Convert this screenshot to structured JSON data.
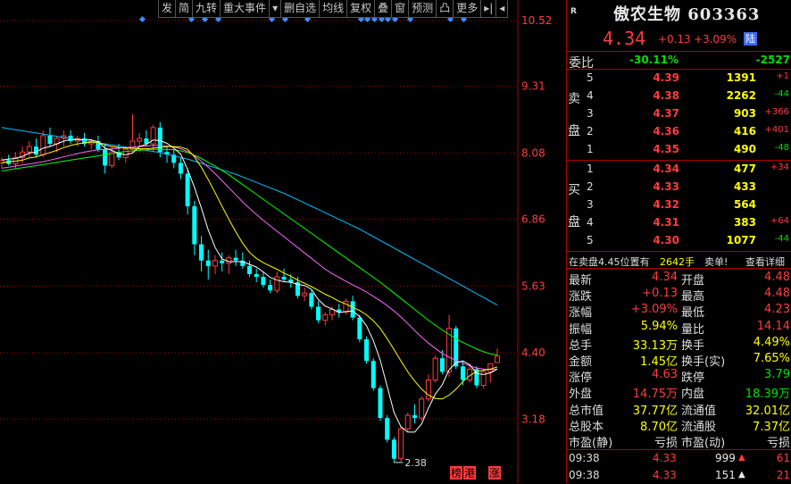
{
  "toolbar": {
    "buttons": [
      "发",
      "简",
      "九转",
      "重大事件",
      "▾",
      "删自选",
      "均线",
      "复权",
      "叠",
      "窗",
      "预测",
      "凸",
      "更多",
      "▸|",
      "◂"
    ]
  },
  "stock": {
    "tag": "R",
    "name": "傲农生物",
    "code": "603363",
    "price": "4.34",
    "change": "+0.13",
    "change_pct": "+3.09%",
    "market": "陆"
  },
  "webi": {
    "label": "委比",
    "pct": "-30.11%",
    "diff": "-2527"
  },
  "order_book": {
    "sell_label": [
      "卖",
      "盘"
    ],
    "buy_label": [
      "买",
      "盘"
    ],
    "sells": [
      {
        "idx": "5",
        "price": "4.39",
        "vol": "1391",
        "chg": "+1"
      },
      {
        "idx": "4",
        "price": "4.38",
        "vol": "2262",
        "chg": "-44"
      },
      {
        "idx": "3",
        "price": "4.37",
        "vol": "903",
        "chg": "+366"
      },
      {
        "idx": "2",
        "price": "4.36",
        "vol": "416",
        "chg": "+401"
      },
      {
        "idx": "1",
        "price": "4.35",
        "vol": "490",
        "chg": "-48"
      }
    ],
    "buys": [
      {
        "idx": "1",
        "price": "4.34",
        "vol": "477",
        "chg": "+34"
      },
      {
        "idx": "2",
        "price": "4.33",
        "vol": "433",
        "chg": ""
      },
      {
        "idx": "3",
        "price": "4.32",
        "vol": "564",
        "chg": ""
      },
      {
        "idx": "4",
        "price": "4.31",
        "vol": "383",
        "chg": "+64"
      },
      {
        "idx": "5",
        "price": "4.30",
        "vol": "1077",
        "chg": "-44"
      }
    ]
  },
  "notice": {
    "text": "在卖盘4.45位置有",
    "amount": "2642手",
    "label": "卖单!",
    "link": "查看详细"
  },
  "stats": [
    {
      "l1": "最新",
      "v1": "4.34",
      "c1": "red",
      "l2": "开盘",
      "v2": "4.48",
      "c2": "red"
    },
    {
      "l1": "涨跌",
      "v1": "+0.13",
      "c1": "red",
      "l2": "最高",
      "v2": "4.48",
      "c2": "red"
    },
    {
      "l1": "涨幅",
      "v1": "+3.09%",
      "c1": "red",
      "l2": "最低",
      "v2": "4.23",
      "c2": "red"
    },
    {
      "l1": "振幅",
      "v1": "5.94%",
      "c1": "yellow",
      "l2": "量比",
      "v2": "14.14",
      "c2": "red"
    },
    {
      "l1": "总手",
      "v1": "33.13万",
      "c1": "yellow",
      "l2": "换手",
      "v2": "4.49%",
      "c2": "yellow"
    },
    {
      "l1": "金额",
      "v1": "1.45亿",
      "c1": "yellow",
      "l2": "换手(实)",
      "v2": "7.65%",
      "c2": "yellow"
    },
    {
      "l1": "涨停",
      "v1": "4.63",
      "c1": "red",
      "l2": "跌停",
      "v2": "3.79",
      "c2": "green"
    },
    {
      "l1": "外盘",
      "v1": "14.75万",
      "c1": "red",
      "l2": "内盘",
      "v2": "18.39万",
      "c2": "green"
    },
    {
      "l1": "总市值",
      "v1": "37.77亿",
      "c1": "yellow",
      "l2": "流通值",
      "v2": "32.01亿",
      "c2": "yellow"
    },
    {
      "l1": "总股本",
      "v1": "8.70亿",
      "c1": "yellow",
      "l2": "流通股",
      "v2": "7.37亿",
      "c2": "yellow"
    },
    {
      "l1": "市盈(静)",
      "v1": "亏损",
      "c1": "white",
      "l2": "市盈(动)",
      "v2": "亏损",
      "c2": "white"
    }
  ],
  "ticks": [
    {
      "time": "09:38",
      "price": "4.33",
      "vol": "999",
      "count": "61"
    },
    {
      "time": "09:38",
      "price": "4.33",
      "vol": "151",
      "count": "21"
    }
  ],
  "colors": {
    "up": "#ff3c3c",
    "down": "#00ffff",
    "grid": "#b00000",
    "ma5": "#ffffff",
    "ma10": "#ffff00",
    "ma20": "#ff66ff",
    "ma30": "#00ff00",
    "ma60": "#00bfff"
  },
  "chart_data": {
    "type": "candlestick",
    "y_ticks": [
      10.52,
      9.31,
      8.08,
      6.86,
      5.63,
      4.4,
      3.18
    ],
    "ylim": [
      2.0,
      10.9
    ],
    "low_annotation": "2.38",
    "bottom_tags": [
      "榜",
      "港",
      "涨"
    ],
    "ohlc": [
      [
        7.9,
        8.0,
        7.8,
        7.95
      ],
      [
        7.95,
        8.05,
        7.85,
        7.88
      ],
      [
        7.88,
        8.1,
        7.8,
        8.0
      ],
      [
        8.0,
        8.2,
        7.9,
        8.1
      ],
      [
        8.1,
        8.3,
        8.0,
        8.2
      ],
      [
        8.2,
        8.35,
        8.0,
        8.05
      ],
      [
        8.05,
        8.5,
        8.0,
        8.4
      ],
      [
        8.4,
        8.55,
        8.2,
        8.25
      ],
      [
        8.25,
        8.4,
        8.1,
        8.35
      ],
      [
        8.35,
        8.5,
        8.2,
        8.4
      ],
      [
        8.4,
        8.5,
        8.25,
        8.3
      ],
      [
        8.3,
        8.4,
        8.2,
        8.35
      ],
      [
        8.35,
        8.45,
        8.2,
        8.25
      ],
      [
        8.25,
        8.35,
        8.15,
        8.3
      ],
      [
        8.3,
        8.4,
        8.1,
        8.15
      ],
      [
        8.15,
        8.25,
        7.7,
        7.85
      ],
      [
        7.85,
        8.2,
        7.8,
        8.1
      ],
      [
        8.1,
        8.25,
        7.95,
        8.0
      ],
      [
        8.0,
        8.2,
        7.9,
        8.15
      ],
      [
        8.15,
        8.8,
        8.1,
        8.3
      ],
      [
        8.3,
        8.45,
        8.2,
        8.35
      ],
      [
        8.35,
        8.5,
        8.2,
        8.25
      ],
      [
        8.25,
        8.6,
        8.1,
        8.55
      ],
      [
        8.55,
        8.65,
        8.0,
        8.1
      ],
      [
        8.1,
        8.2,
        7.9,
        8.05
      ],
      [
        8.05,
        8.15,
        7.8,
        7.9
      ],
      [
        7.9,
        8.0,
        7.6,
        7.7
      ],
      [
        7.7,
        7.8,
        6.95,
        7.1
      ],
      [
        7.1,
        7.2,
        6.2,
        6.4
      ],
      [
        6.4,
        6.55,
        5.9,
        6.1
      ],
      [
        6.1,
        6.3,
        5.75,
        6.0
      ],
      [
        6.0,
        6.2,
        5.85,
        6.1
      ],
      [
        6.1,
        6.25,
        5.9,
        6.05
      ],
      [
        6.05,
        6.2,
        5.85,
        6.15
      ],
      [
        6.15,
        6.3,
        6.0,
        6.1
      ],
      [
        6.1,
        6.25,
        5.95,
        6.0
      ],
      [
        6.0,
        6.1,
        5.8,
        5.85
      ],
      [
        5.85,
        5.95,
        5.7,
        5.8
      ],
      [
        5.8,
        5.9,
        5.6,
        5.65
      ],
      [
        5.65,
        5.75,
        5.5,
        5.55
      ],
      [
        5.55,
        5.9,
        5.5,
        5.8
      ],
      [
        5.8,
        5.95,
        5.7,
        5.75
      ],
      [
        5.75,
        5.85,
        5.6,
        5.7
      ],
      [
        5.7,
        5.8,
        5.4,
        5.45
      ],
      [
        5.45,
        5.6,
        5.35,
        5.5
      ],
      [
        5.5,
        5.55,
        5.2,
        5.25
      ],
      [
        5.25,
        5.35,
        4.95,
        5.0
      ],
      [
        5.0,
        5.15,
        4.9,
        5.1
      ],
      [
        5.1,
        5.25,
        5.0,
        5.2
      ],
      [
        5.2,
        5.3,
        5.05,
        5.15
      ],
      [
        5.15,
        5.4,
        5.1,
        5.35
      ],
      [
        5.35,
        5.45,
        5.0,
        5.05
      ],
      [
        5.05,
        5.1,
        4.6,
        4.65
      ],
      [
        4.65,
        4.7,
        4.2,
        4.25
      ],
      [
        4.25,
        4.3,
        3.7,
        3.75
      ],
      [
        3.75,
        3.8,
        3.15,
        3.2
      ],
      [
        3.2,
        3.25,
        2.75,
        2.8
      ],
      [
        2.8,
        2.85,
        2.38,
        2.45
      ],
      [
        2.45,
        3.05,
        2.4,
        3.0
      ],
      [
        3.0,
        3.3,
        2.95,
        3.25
      ],
      [
        3.25,
        3.45,
        3.1,
        3.2
      ],
      [
        3.2,
        3.6,
        3.15,
        3.55
      ],
      [
        3.55,
        4.0,
        3.5,
        3.9
      ],
      [
        3.9,
        4.35,
        3.85,
        4.3
      ],
      [
        4.3,
        4.45,
        4.0,
        4.05
      ],
      [
        4.05,
        5.1,
        3.95,
        4.85
      ],
      [
        4.85,
        4.9,
        4.1,
        4.15
      ],
      [
        4.15,
        4.25,
        3.8,
        3.9
      ],
      [
        3.9,
        4.2,
        3.85,
        4.1
      ],
      [
        4.1,
        4.15,
        3.75,
        3.8
      ],
      [
        3.8,
        4.1,
        3.75,
        4.05
      ],
      [
        4.05,
        4.2,
        3.85,
        4.2
      ],
      [
        4.22,
        4.48,
        4.23,
        4.34
      ]
    ],
    "ma5": [
      7.95,
      7.97,
      7.98,
      8.02,
      8.08,
      8.1,
      8.17,
      8.2,
      8.25,
      8.3,
      8.33,
      8.33,
      8.33,
      8.32,
      8.29,
      8.17,
      8.13,
      8.07,
      8.05,
      8.08,
      8.2,
      8.24,
      8.32,
      8.31,
      8.26,
      8.17,
      8.06,
      7.78,
      7.45,
      7.07,
      6.66,
      6.34,
      6.13,
      6.08,
      6.08,
      6.08,
      6.03,
      5.98,
      5.89,
      5.79,
      5.74,
      5.71,
      5.7,
      5.66,
      5.64,
      5.57,
      5.38,
      5.26,
      5.21,
      5.14,
      5.16,
      5.17,
      5.07,
      4.9,
      4.62,
      4.26,
      3.78,
      3.3,
      3.04,
      2.94,
      2.94,
      3.09,
      3.38,
      3.64,
      3.81,
      4.09,
      4.22,
      4.25,
      4.18,
      4.02,
      4.0,
      4.03,
      4.1
    ],
    "ma10": [
      7.9,
      7.92,
      7.93,
      7.95,
      7.99,
      8.01,
      8.05,
      8.09,
      8.13,
      8.18,
      8.22,
      8.25,
      8.27,
      8.28,
      8.28,
      8.23,
      8.2,
      8.18,
      8.17,
      8.17,
      8.16,
      8.16,
      8.17,
      8.18,
      8.2,
      8.2,
      8.19,
      8.15,
      8.01,
      7.82,
      7.59,
      7.35,
      7.1,
      6.86,
      6.63,
      6.42,
      6.25,
      6.14,
      6.06,
      6.0,
      5.94,
      5.87,
      5.81,
      5.74,
      5.68,
      5.62,
      5.55,
      5.48,
      5.42,
      5.35,
      5.3,
      5.24,
      5.18,
      5.1,
      4.99,
      4.85,
      4.66,
      4.46,
      4.25,
      4.05,
      3.88,
      3.73,
      3.62,
      3.56,
      3.55,
      3.62,
      3.73,
      3.87,
      3.98,
      4.06,
      4.08,
      4.1,
      4.14
    ],
    "ma20": [
      7.8,
      7.82,
      7.84,
      7.86,
      7.88,
      7.9,
      7.92,
      7.95,
      7.98,
      8.01,
      8.04,
      8.07,
      8.1,
      8.12,
      8.14,
      8.15,
      8.16,
      8.17,
      8.18,
      8.19,
      8.2,
      8.21,
      8.22,
      8.22,
      8.21,
      8.19,
      8.16,
      8.11,
      8.03,
      7.93,
      7.82,
      7.7,
      7.57,
      7.44,
      7.31,
      7.18,
      7.06,
      6.95,
      6.84,
      6.74,
      6.64,
      6.54,
      6.44,
      6.34,
      6.24,
      6.14,
      6.04,
      5.94,
      5.86,
      5.79,
      5.72,
      5.65,
      5.59,
      5.52,
      5.44,
      5.36,
      5.27,
      5.17,
      5.06,
      4.94,
      4.81,
      4.69,
      4.58,
      4.48,
      4.39,
      4.32,
      4.26,
      4.21,
      4.16,
      4.12,
      4.1,
      4.09,
      4.1
    ],
    "ma30": [
      7.75,
      7.77,
      7.79,
      7.81,
      7.83,
      7.85,
      7.87,
      7.89,
      7.91,
      7.93,
      7.95,
      7.97,
      7.99,
      8.01,
      8.03,
      8.05,
      8.07,
      8.09,
      8.11,
      8.12,
      8.13,
      8.14,
      8.15,
      8.15,
      8.15,
      8.14,
      8.12,
      8.09,
      8.04,
      7.98,
      7.91,
      7.84,
      7.76,
      7.68,
      7.59,
      7.5,
      7.41,
      7.32,
      7.23,
      7.14,
      7.05,
      6.96,
      6.87,
      6.78,
      6.69,
      6.6,
      6.51,
      6.42,
      6.33,
      6.24,
      6.15,
      6.06,
      5.97,
      5.88,
      5.79,
      5.7,
      5.6,
      5.5,
      5.4,
      5.3,
      5.2,
      5.1,
      5.0,
      4.91,
      4.82,
      4.74,
      4.66,
      4.59,
      4.53,
      4.47,
      4.42,
      4.38,
      4.36
    ],
    "ma60": [
      8.55,
      8.53,
      8.51,
      8.49,
      8.47,
      8.45,
      8.43,
      8.41,
      8.39,
      8.37,
      8.35,
      8.33,
      8.31,
      8.29,
      8.27,
      8.25,
      8.23,
      8.21,
      8.19,
      8.17,
      8.15,
      8.13,
      8.11,
      8.09,
      8.06,
      8.03,
      8.0,
      7.97,
      7.93,
      7.89,
      7.85,
      7.81,
      7.77,
      7.73,
      7.69,
      7.64,
      7.59,
      7.54,
      7.49,
      7.44,
      7.39,
      7.34,
      7.28,
      7.22,
      7.16,
      7.1,
      7.04,
      6.98,
      6.92,
      6.86,
      6.8,
      6.74,
      6.68,
      6.61,
      6.54,
      6.47,
      6.4,
      6.33,
      6.26,
      6.19,
      6.12,
      6.05,
      5.98,
      5.91,
      5.84,
      5.77,
      5.7,
      5.63,
      5.56,
      5.49,
      5.42,
      5.35,
      5.28
    ]
  }
}
